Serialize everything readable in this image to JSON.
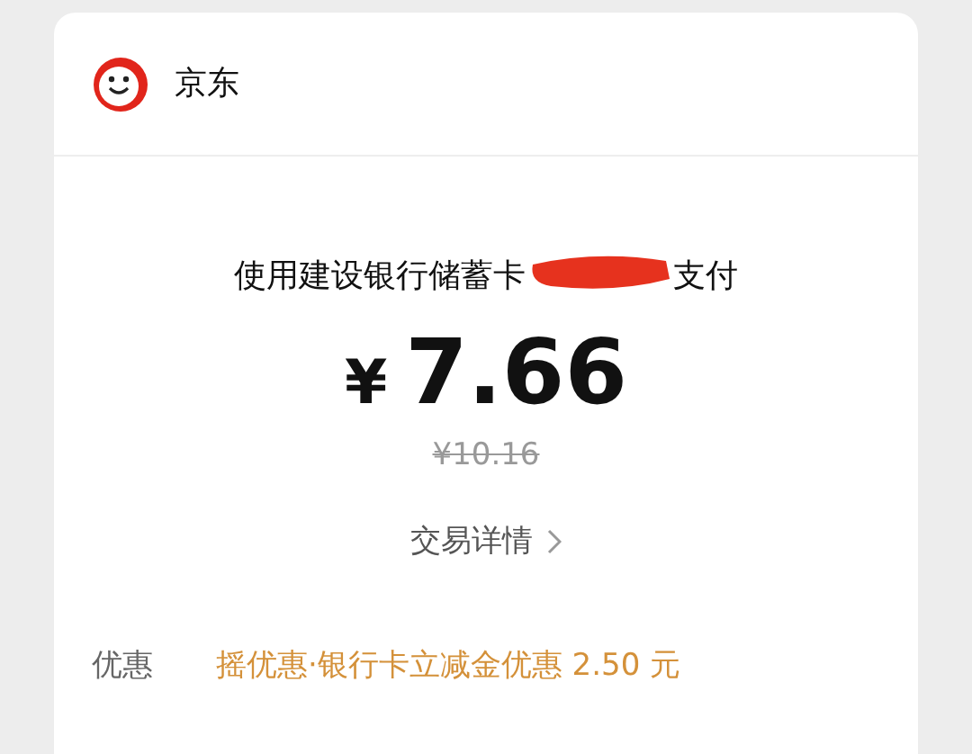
{
  "merchant": {
    "name": "京东"
  },
  "payment": {
    "method_prefix": "使用建设银行储蓄卡",
    "method_suffix": "支付",
    "currency": "¥",
    "amount": "7.66",
    "original_price": "¥10.16",
    "details_link": "交易详情"
  },
  "discount": {
    "label": "优惠",
    "value": "摇优惠·银行卡立减金优惠 2.50 元"
  }
}
